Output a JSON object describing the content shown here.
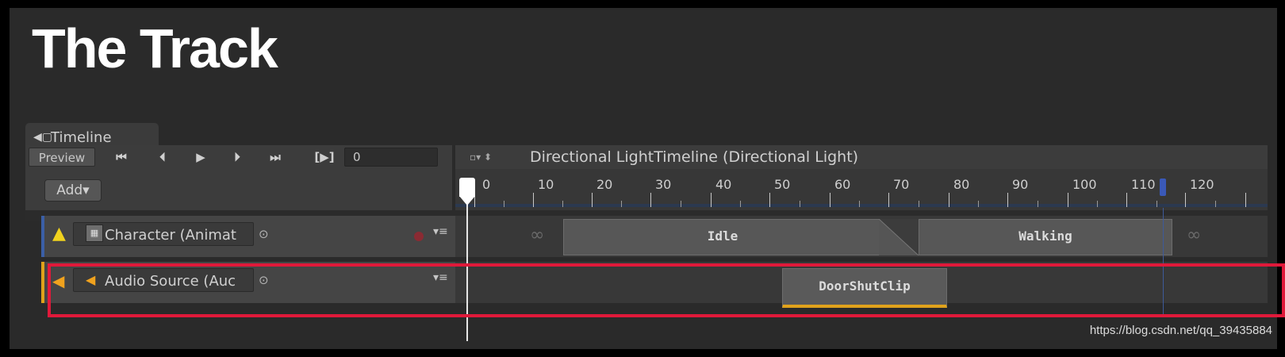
{
  "slide": {
    "title": "The Track"
  },
  "window": {
    "tab_label": "Timeline",
    "tab_icon": "timeline-window-icon"
  },
  "toolbar": {
    "preview_label": "Preview",
    "buttons": [
      "⏮",
      "⏴",
      "▶",
      "⏵",
      "⏭"
    ],
    "play_range_label": "[▶]",
    "frame_value": "0",
    "timeline_menu": "▫▾ ⬍",
    "timeline_name": "Directional LightTimeline (Directional Light)"
  },
  "header": {
    "add_label": "Add▾"
  },
  "ruler": {
    "labels": [
      "0",
      "10",
      "20",
      "30",
      "40",
      "50",
      "60",
      "70",
      "80",
      "90",
      "100",
      "110",
      "120"
    ]
  },
  "tracks": [
    {
      "binding": "Character (Animat",
      "warning_icon": "warning-icon",
      "type_icon": "animator-icon",
      "clips": [
        "Idle",
        "Walking"
      ]
    },
    {
      "binding": "Audio Source (Auc",
      "type_icon": "speaker-icon",
      "clips": [
        "DoorShutClip"
      ]
    }
  ],
  "track_menu": "▾≡",
  "infinity": "∞",
  "colors": {
    "accent_audio": "#e0a21b",
    "accent_anim": "#3b5fa6",
    "highlight": "#e0193a",
    "playhead": "#ffffff"
  },
  "watermark": "https://blog.csdn.net/qq_39435884"
}
